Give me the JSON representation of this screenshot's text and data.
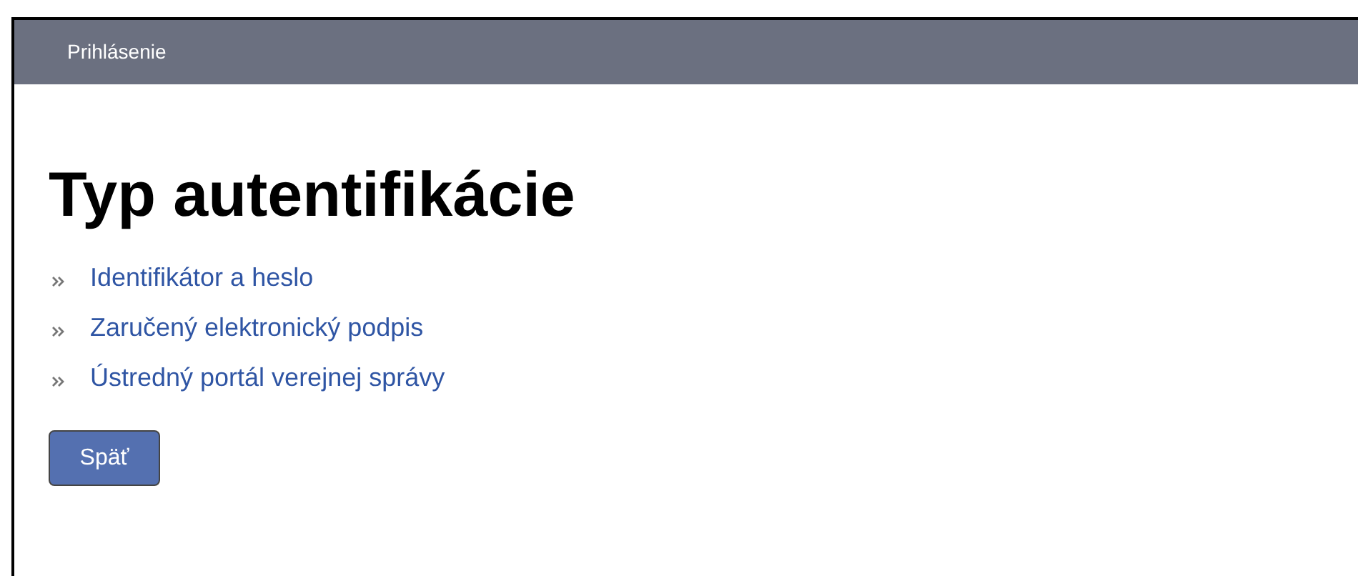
{
  "header": {
    "title": "Prihlásenie"
  },
  "heading": "Typ autentifikácie",
  "links": [
    {
      "label": "Identifikátor a heslo"
    },
    {
      "label": "Zaručený elektronický podpis"
    },
    {
      "label": "Ústredný portál verejnej správy"
    }
  ],
  "buttons": [
    "Späť"
  ]
}
